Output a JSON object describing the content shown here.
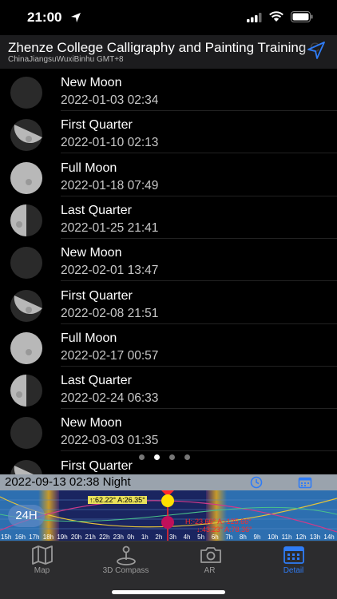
{
  "status_bar": {
    "time": "21:00"
  },
  "header": {
    "title": "Zhenze College Calligraphy and Painting Training C",
    "subtitle": "ChinaJiangsuWuxiBinhu GMT+8"
  },
  "moon_phases": [
    {
      "phase": "New Moon",
      "date": "2022-01-03 02:34",
      "illumination": 0.0
    },
    {
      "phase": "First Quarter",
      "date": "2022-01-10 02:13",
      "illumination": 0.5
    },
    {
      "phase": "Full Moon",
      "date": "2022-01-18 07:49",
      "illumination": 1.0
    },
    {
      "phase": "Last Quarter",
      "date": "2022-01-25 21:41",
      "illumination": 0.5
    },
    {
      "phase": "New Moon",
      "date": "2022-02-01 13:47",
      "illumination": 0.0
    },
    {
      "phase": "First Quarter",
      "date": "2022-02-08 21:51",
      "illumination": 0.5
    },
    {
      "phase": "Full Moon",
      "date": "2022-02-17 00:57",
      "illumination": 1.0
    },
    {
      "phase": "Last Quarter",
      "date": "2022-02-24 06:33",
      "illumination": 0.5
    },
    {
      "phase": "New Moon",
      "date": "2022-03-03 01:35",
      "illumination": 0.0
    },
    {
      "phase": "First Quarter",
      "date": "",
      "illumination": 0.5
    }
  ],
  "pager": {
    "count": 4,
    "active_index": 1
  },
  "time_bar": {
    "label": "2022-09-13 02:38 Night"
  },
  "sun_strip": {
    "hour_button": "24H",
    "sun_readout": "↑:62.22° A:26.35°",
    "moon_readout_1": "H:-23.66° A:-125.66°",
    "moon_readout_2": "↓:43.23° A:78.36°",
    "hours": [
      "15h",
      "16h",
      "17h",
      "18h",
      "19h",
      "20h",
      "21h",
      "22h",
      "23h",
      "0h",
      "1h",
      "2h",
      "3h",
      "4h",
      "5h",
      "6h",
      "7h",
      "8h",
      "9h",
      "10h",
      "11h",
      "12h",
      "13h",
      "14h"
    ]
  },
  "tabs": [
    {
      "label": "Map",
      "icon": "map-icon"
    },
    {
      "label": "3D Compass",
      "icon": "compass-icon"
    },
    {
      "label": "AR",
      "icon": "camera-icon"
    },
    {
      "label": "Detail",
      "icon": "calendar-icon",
      "active": true
    }
  ],
  "colors": {
    "accent": "#2f7cf6",
    "tab_bar": "#2c2c2e",
    "header": "#1c1c1e",
    "sun": "#ffe000",
    "moon_marker": "#c0105a"
  }
}
